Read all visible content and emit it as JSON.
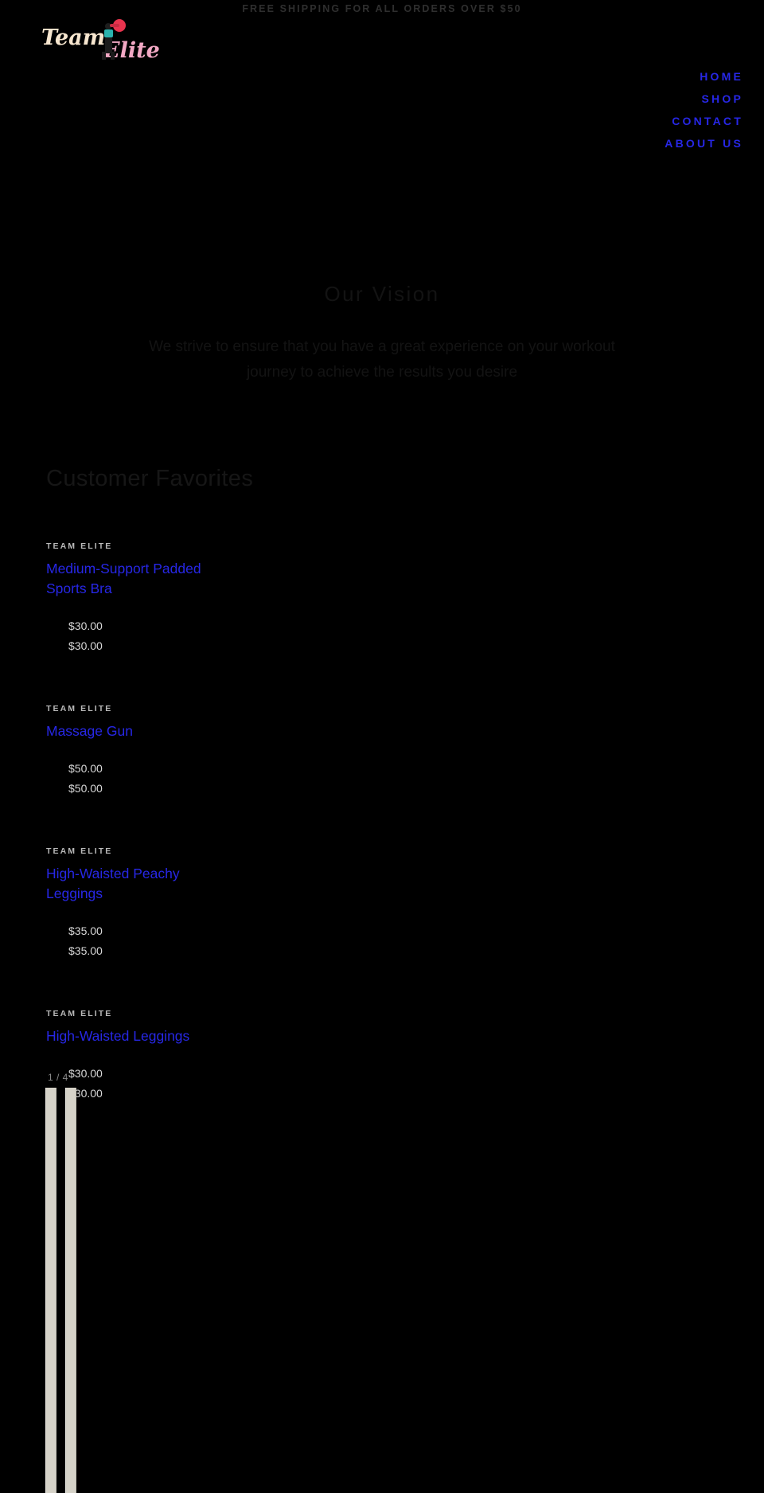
{
  "announcement": {
    "text": "FREE SHIPPING FOR ALL ORDERS OVER $50"
  },
  "header": {
    "logo": {
      "word_one": "Team",
      "word_two": "Elite",
      "icon": "lifter-with-dumbbell-icon",
      "color_word_one": "#f7e6cf",
      "color_word_two": "#f2a8c4"
    }
  },
  "nav": {
    "items": [
      {
        "label": "HOME"
      },
      {
        "label": "SHOP"
      },
      {
        "label": "CONTACT"
      },
      {
        "label": "ABOUT US"
      }
    ],
    "link_color": "#2727e6"
  },
  "vision": {
    "title": "Our Vision",
    "body": "We strive to ensure that you have a great experience on your workout journey to achieve the results you desire"
  },
  "favorites": {
    "title": "Customer Favorites",
    "products": [
      {
        "vendor": "TEAM ELITE",
        "title": "Medium-Support Padded Sports Bra",
        "price_regular": "$30.00",
        "price_sale": "$30.00"
      },
      {
        "vendor": "TEAM ELITE",
        "title": "Massage Gun",
        "price_regular": "$50.00",
        "price_sale": "$50.00"
      },
      {
        "vendor": "TEAM ELITE",
        "title": "High-Waisted Peachy Leggings",
        "price_regular": "$35.00",
        "price_sale": "$35.00"
      },
      {
        "vendor": "TEAM ELITE",
        "title": "High-Waisted Leggings",
        "price_regular": "$30.00",
        "price_sale": "$30.00"
      }
    ],
    "pagination": "1 / 4"
  }
}
